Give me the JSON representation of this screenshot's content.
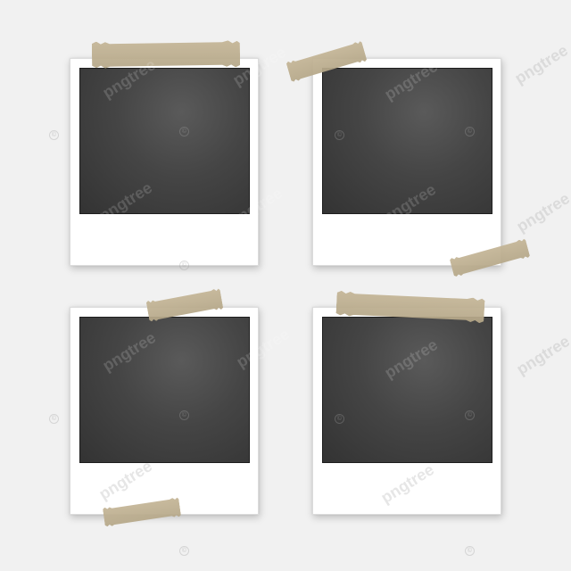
{
  "watermark": {
    "brand_text": "pngtree",
    "copyright_symbol": "©"
  },
  "frames": [
    {
      "id": "top-left",
      "photo": "empty"
    },
    {
      "id": "top-right",
      "photo": "empty"
    },
    {
      "id": "bottom-left",
      "photo": "empty"
    },
    {
      "id": "bottom-right",
      "photo": "empty"
    }
  ],
  "colors": {
    "background": "#f1f1f1",
    "frame": "#ffffff",
    "photo_dark": "#3c3c3c",
    "tape": "#bfb293"
  }
}
